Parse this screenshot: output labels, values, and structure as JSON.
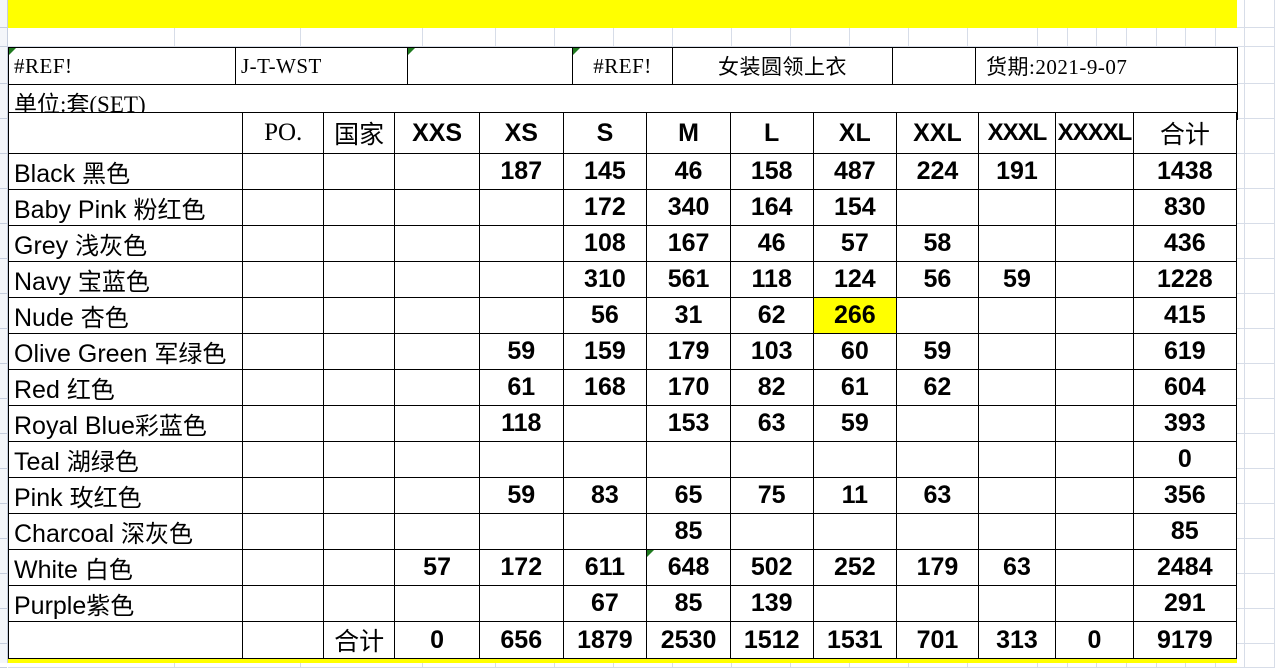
{
  "document": {
    "unit_label": "单位:套(SET)",
    "info_row": {
      "ref_left": "#REF!",
      "style_code": "J-T-WST",
      "ref_mid": "#REF!",
      "product_name": "女装圆领上衣",
      "delivery": "货期:2021-9-07"
    }
  },
  "table": {
    "columns": [
      "",
      "PO.",
      "国家",
      "XXS",
      "XS",
      "S",
      "M",
      "L",
      "XL",
      "XXL",
      "XXXL",
      "XXXXL",
      "合计"
    ],
    "total_label": "合计",
    "rows": [
      {
        "label_en": "Black",
        "label_cn": "黑色",
        "po": "",
        "country": "",
        "cells": [
          "",
          "187",
          "145",
          "46",
          "158",
          "487",
          "224",
          "191",
          ""
        ],
        "total": "1438"
      },
      {
        "label_en": "Baby Pink",
        "label_cn": "粉红色",
        "po": "",
        "country": "",
        "cells": [
          "",
          "",
          "172",
          "340",
          "164",
          "154",
          "",
          "",
          ""
        ],
        "total": "830"
      },
      {
        "label_en": "Grey",
        "label_cn": "浅灰色",
        "po": "",
        "country": "",
        "cells": [
          "",
          "",
          "108",
          "167",
          "46",
          "57",
          "58",
          "",
          ""
        ],
        "total": "436"
      },
      {
        "label_en": "Navy",
        "label_cn": "宝蓝色",
        "po": "",
        "country": "",
        "cells": [
          "",
          "",
          "310",
          "561",
          "118",
          "124",
          "56",
          "59",
          ""
        ],
        "total": "1228"
      },
      {
        "label_en": "Nude",
        "label_cn": "杏色",
        "po": "",
        "country": "",
        "cells": [
          "",
          "",
          "56",
          "31",
          "62",
          "266",
          "",
          "",
          ""
        ],
        "total": "415",
        "highlight": 5
      },
      {
        "label_en": "Olive Green",
        "label_cn": "军绿色",
        "po": "",
        "country": "",
        "cells": [
          "",
          "59",
          "159",
          "179",
          "103",
          "60",
          "59",
          "",
          ""
        ],
        "total": "619"
      },
      {
        "label_en": "Red",
        "label_cn": "红色",
        "po": "",
        "country": "",
        "cells": [
          "",
          "61",
          "168",
          "170",
          "82",
          "61",
          "62",
          "",
          ""
        ],
        "total": "604"
      },
      {
        "label_en": "Royal Blue",
        "label_cn": "彩蓝色",
        "nospace": true,
        "po": "",
        "country": "",
        "cells": [
          "",
          "118",
          "",
          "153",
          "63",
          "59",
          "",
          "",
          ""
        ],
        "total": "393"
      },
      {
        "label_en": "Teal",
        "label_cn": "湖绿色",
        "po": "",
        "country": "",
        "cells": [
          "",
          "",
          "",
          "",
          "",
          "",
          "",
          "",
          ""
        ],
        "total": "0"
      },
      {
        "label_en": "Pink",
        "label_cn": "玫红色",
        "po": "",
        "country": "",
        "cells": [
          "",
          "59",
          "83",
          "65",
          "75",
          "11",
          "63",
          "",
          ""
        ],
        "total": "356"
      },
      {
        "label_en": "Charcoal",
        "label_cn": "深灰色",
        "po": "",
        "country": "",
        "cells": [
          "",
          "",
          "",
          "85",
          "",
          "",
          "",
          "",
          ""
        ],
        "total": "85"
      },
      {
        "label_en": "White",
        "label_cn": "白色",
        "po": "",
        "country": "",
        "cells": [
          "57",
          "172",
          "611",
          "648",
          "502",
          "252",
          "179",
          "63",
          ""
        ],
        "total": "2484",
        "comment": 3
      },
      {
        "label_en": "Purple",
        "label_cn": "紫色",
        "nospace": true,
        "po": "",
        "country": "",
        "cells": [
          "",
          "",
          "67",
          "85",
          "139",
          "",
          "",
          "",
          ""
        ],
        "total": "291"
      }
    ],
    "totals": [
      "0",
      "656",
      "1879",
      "2530",
      "1512",
      "1531",
      "701",
      "313",
      "0"
    ],
    "grand_total": "9179"
  },
  "colors": {
    "highlight": "#ffff00",
    "banner": "#ffff00",
    "grid": "#d7dde8",
    "border": "#000000"
  }
}
